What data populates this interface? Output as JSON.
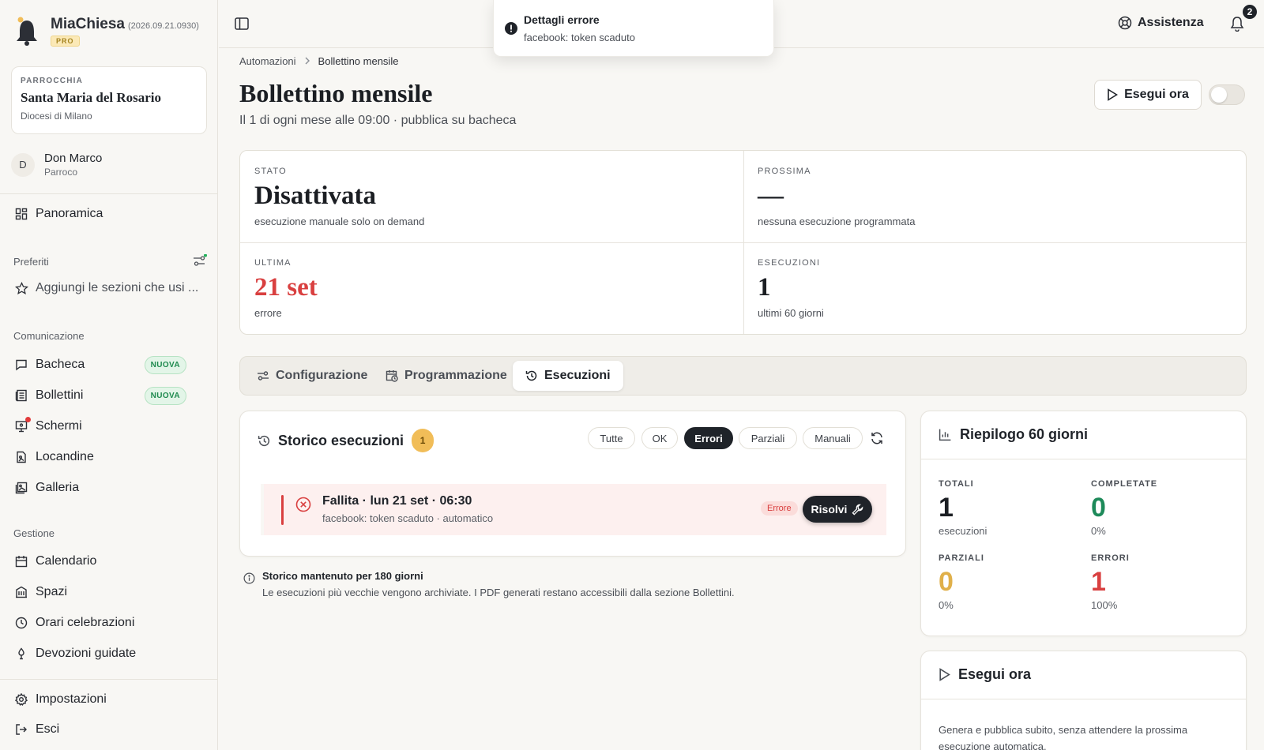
{
  "app": {
    "name": "MiaChiesa",
    "version": "(2026.09.21.0930)",
    "plan": "PRO"
  },
  "parish": {
    "kicker": "PARROCCHIA",
    "name": "Santa Maria del Rosario",
    "diocese": "Diocesi di Milano"
  },
  "user": {
    "initial": "D",
    "name": "Don Marco",
    "role": "Parroco"
  },
  "nav": {
    "overview": "Panoramica",
    "favorites_title": "Preferiti",
    "favorites_hint": "Aggiungi le sezioni che usi ...",
    "communication_title": "Comunicazione",
    "communication": [
      {
        "label": "Bacheca",
        "tag": "NUOVA"
      },
      {
        "label": "Bollettini",
        "tag": "NUOVA"
      },
      {
        "label": "Schermi"
      },
      {
        "label": "Locandine"
      },
      {
        "label": "Galleria"
      }
    ],
    "management_title": "Gestione",
    "management": [
      {
        "label": "Calendario"
      },
      {
        "label": "Spazi"
      },
      {
        "label": "Orari celebrazioni"
      },
      {
        "label": "Devozioni guidate"
      }
    ],
    "settings": "Impostazioni",
    "logout": "Esci"
  },
  "topbar": {
    "help": "Assistenza",
    "notifications_count": "2"
  },
  "toast": {
    "title": "Dettagli errore",
    "message": "facebook: token scaduto"
  },
  "breadcrumb": {
    "parent": "Automazioni",
    "current": "Bollettino mensile"
  },
  "page": {
    "title": "Bollettino mensile",
    "subtitle": "Il 1 di ogni mese alle 09:00 · pubblica su bacheca",
    "run_button": "Esegui ora",
    "enabled": false
  },
  "stats": [
    {
      "key": "STATO",
      "value": "Disattivata",
      "desc": "esecuzione manuale solo on demand"
    },
    {
      "key": "PROSSIMA",
      "value": "—",
      "desc": "nessuna esecuzione programmata"
    },
    {
      "key": "ULTIMA",
      "value": "21 set",
      "desc": "errore"
    },
    {
      "key": "ESECUZIONI",
      "value": "1",
      "desc": "ultimi 60 giorni"
    }
  ],
  "tabs": [
    {
      "label": "Configurazione"
    },
    {
      "label": "Programmazione"
    },
    {
      "label": "Esecuzioni",
      "active": true
    }
  ],
  "history": {
    "title": "Storico esecuzioni",
    "count": "1",
    "filters": [
      "Tutte",
      "OK",
      "Errori",
      "Parziali",
      "Manuali"
    ],
    "active_filter": "Errori",
    "runs": [
      {
        "title": "Fallita · lun 21 set · 06:30",
        "detail": "facebook: token scaduto · automatico",
        "status": "Errore",
        "action": "Risolvi"
      }
    ],
    "note_title": "Storico mantenuto per 180 giorni",
    "note_text": "Le esecuzioni più vecchie vengono archiviate. I PDF generati restano accessibili dalla sezione Bollettini."
  },
  "summary": {
    "title": "Riepilogo 60 giorni",
    "items": [
      {
        "key": "TOTALI",
        "value": "1",
        "desc": "esecuzioni",
        "color": "#1b1e23"
      },
      {
        "key": "COMPLETATE",
        "value": "0",
        "desc": "0%",
        "color": "#1e8a5a"
      },
      {
        "key": "PARZIALI",
        "value": "0",
        "desc": "0%",
        "color": "#e0b04a"
      },
      {
        "key": "ERRORI",
        "value": "1",
        "desc": "100%",
        "color": "#d94040"
      }
    ]
  },
  "run_now": {
    "title": "Esegui ora",
    "desc": "Genera e pubblica subito, senza attendere la prossima esecuzione automatica."
  }
}
